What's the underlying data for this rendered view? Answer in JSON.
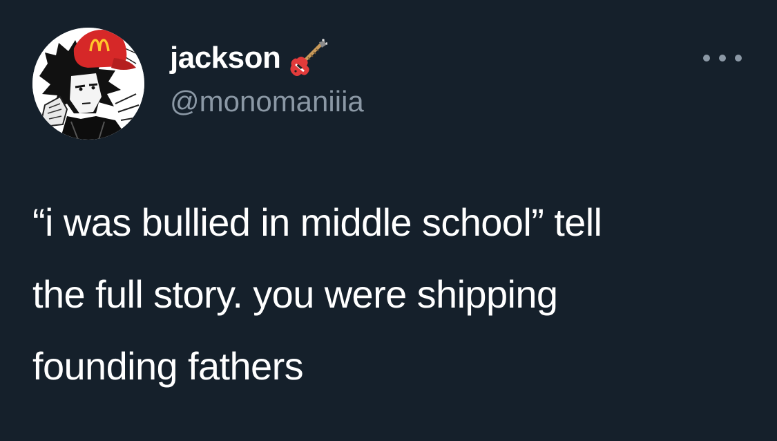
{
  "tweet": {
    "author": {
      "display_name": "jackson",
      "name_emoji": "guitar-emoji",
      "handle": "@monomaniiia",
      "avatar_icon": "anime-avatar-with-red-cap"
    },
    "more_icon": "more-options-icon",
    "text_lines": [
      "“i was bullied in middle school” tell",
      "the full story. you were shipping",
      "founding fathers"
    ]
  },
  "colors": {
    "background": "#15202b",
    "text_primary": "#ffffff",
    "text_secondary": "#8b98a5",
    "cap_red": "#d62828",
    "cap_logo": "#ffc72c"
  }
}
